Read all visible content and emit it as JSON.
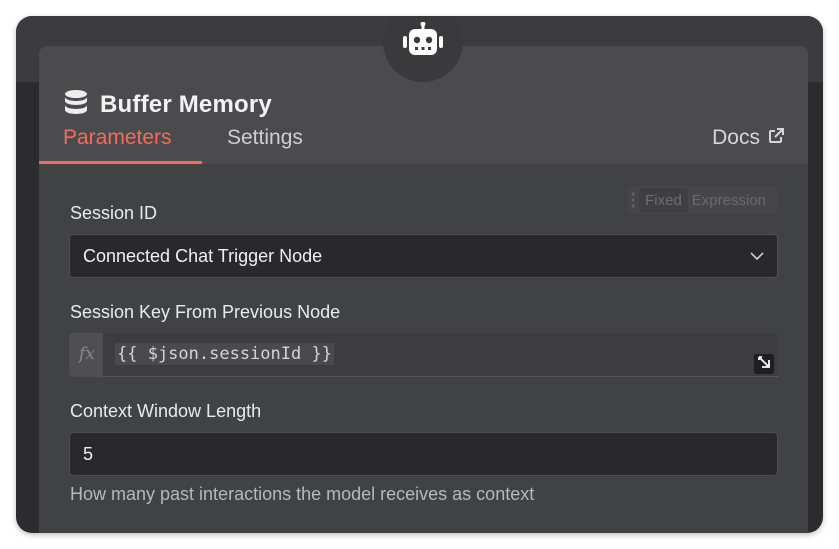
{
  "node": {
    "title": "Buffer Memory",
    "title_icon": "database-icon",
    "badge_icon": "robot-icon"
  },
  "tabs": [
    {
      "label": "Parameters",
      "active": true
    },
    {
      "label": "Settings",
      "active": false
    }
  ],
  "docs": {
    "label": "Docs",
    "icon": "external-link-icon"
  },
  "session_id": {
    "label": "Session ID",
    "value": "Connected Chat Trigger Node",
    "mode_options": [
      "Fixed",
      "Expression"
    ],
    "mode_selected": "Fixed"
  },
  "session_key": {
    "label": "Session Key From Previous Node",
    "fx_label": "fx",
    "expression": "{{ $json.sessionId }}"
  },
  "context_window": {
    "label": "Context Window Length",
    "value": "5",
    "hint": "How many past interactions the model receives as context"
  },
  "colors": {
    "accent": "#f36c5a",
    "panel_bg": "#414244",
    "header_bg": "#4b4b4e",
    "input_bg": "#29292b"
  }
}
